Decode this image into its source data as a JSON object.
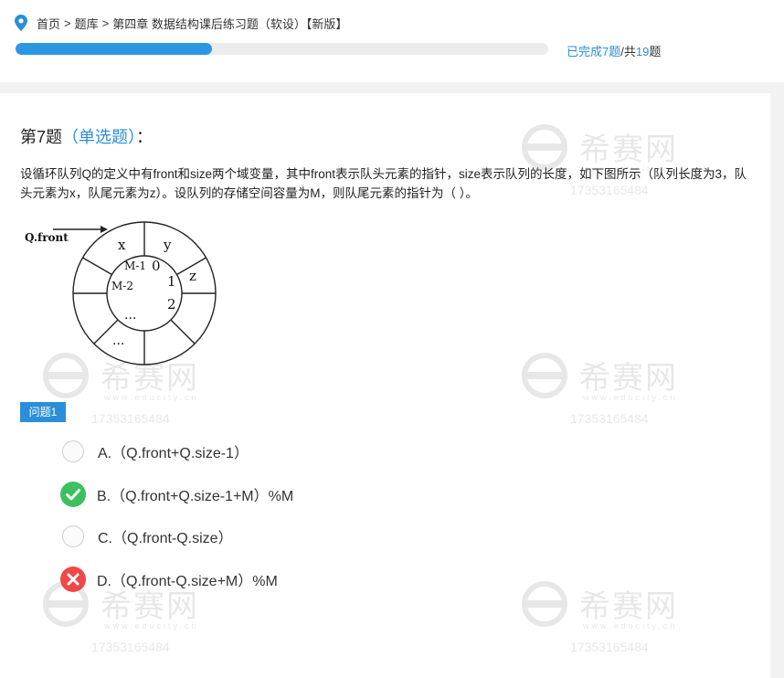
{
  "breadcrumb": {
    "items": [
      "首页",
      "题库",
      "第四章 数据结构课后练习题（软设）【新版】"
    ],
    "separator": ">"
  },
  "progress": {
    "completed": 7,
    "total": 19,
    "prefix": "已完成",
    "unit": "题",
    "total_prefix": "/共",
    "completed_text": "已完成7题",
    "total_text": "/共",
    "total_number": "19",
    "total_unit": "题"
  },
  "question": {
    "title_prefix": "第7题",
    "type_label": "（单选题）",
    "title_suffix": "：",
    "text": "设循环队列Q的定义中有front和size两个域变量，其中front表示队头元素的指针，size表示队列的长度，如下图所示（队列长度为3，队头元素为x，队尾元素为z）。设队列的存储空间容量为M，则队尾元素的指针为（   ）。",
    "diagram": {
      "pointer_label": "Q.front",
      "outer_labels": [
        "x",
        "y",
        "z"
      ],
      "inner_labels": [
        "M-1",
        "0",
        "M-2",
        "1",
        "2",
        "..."
      ],
      "outer_dots": "..."
    }
  },
  "subquestion": {
    "label": "问题1"
  },
  "options": [
    {
      "label": "A.（Q.front+Q.size-1）",
      "state": "unselected"
    },
    {
      "label": "B.（Q.front+Q.size-1+M）%M",
      "state": "correct"
    },
    {
      "label": "C.（Q.front-Q.size）",
      "state": "unselected"
    },
    {
      "label": "D.（Q.front-Q.size+M）%M",
      "state": "wrong"
    }
  ],
  "watermark": {
    "brand": "希赛网",
    "site": "www.educity.cn",
    "phone": "17353165484"
  },
  "colors": {
    "accent": "#2a8fd8",
    "progress_fill": "#2d96e3",
    "correct": "#3cc060",
    "wrong": "#f04848"
  },
  "icons": {
    "breadcrumb": "location-pin-icon",
    "correct": "check-circle-icon",
    "wrong": "x-circle-icon"
  }
}
